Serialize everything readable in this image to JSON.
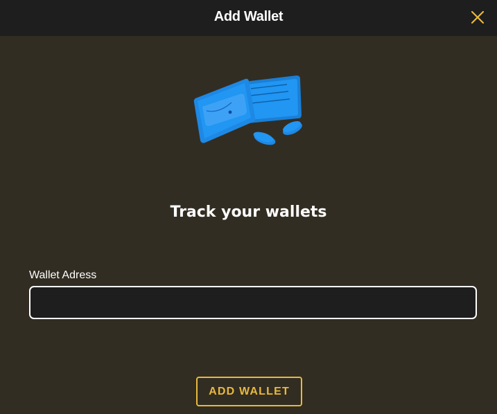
{
  "dialog": {
    "title": "Add Wallet",
    "close_icon": "close-icon",
    "illustration_icon": "wallet-icon",
    "headline": "Track your wallets",
    "form": {
      "label": "Wallet Adress",
      "value": "",
      "placeholder": ""
    },
    "submit_label": "ADD WALLET"
  },
  "colors": {
    "header_bg": "#1e1e1e",
    "body_bg": "#322d22",
    "accent": "#e9b93f",
    "wallet_blue": "#2196f3"
  }
}
